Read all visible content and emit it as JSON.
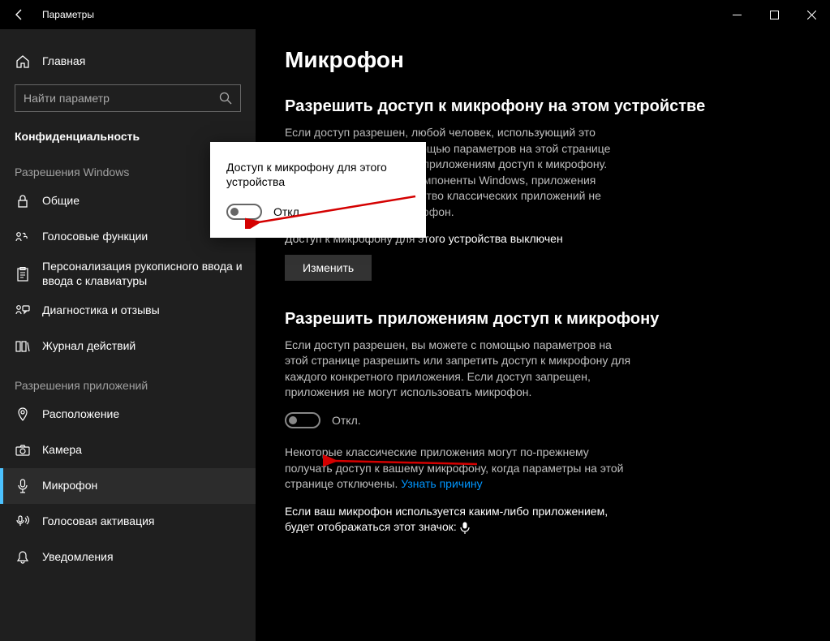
{
  "window": {
    "title": "Параметры"
  },
  "sidebar": {
    "home": "Главная",
    "search_placeholder": "Найти параметр",
    "section": "Конфиденциальность",
    "group1": "Разрешения Windows",
    "items1": [
      "Общие",
      "Голосовые функции",
      "Персонализация рукописного ввода и ввода с клавиатуры",
      "Диагностика и отзывы",
      "Журнал действий"
    ],
    "group2": "Разрешения приложений",
    "items2": [
      "Расположение",
      "Камера",
      "Микрофон",
      "Голосовая активация",
      "Уведомления"
    ]
  },
  "content": {
    "page_title": "Микрофон",
    "h2_1": "Разрешить доступ к микрофону на этом устройстве",
    "desc_1": "Если доступ разрешен, любой человек, использующий это устройство, сможет с помощью параметров на этой странице разрешить или запретить приложениям доступ к микрофону. Если запретить доступ, компоненты Windows, приложения Microsoft Store и большинство классических приложений не смогут использовать микрофон.",
    "status_1": "Доступ к микрофону для этого устройства выключен",
    "change_btn": "Изменить",
    "h2_2": "Разрешить приложениям доступ к микрофону",
    "desc_2": "Если доступ разрешен, вы можете с помощью параметров на этой странице разрешить или запретить доступ к микрофону для каждого конкретного приложения. Если доступ запрещен, приложения не могут использовать микрофон.",
    "toggle_off": "Откл.",
    "desc_3a": "Некоторые классические приложения могут по-прежнему получать доступ к вашему микрофону, когда параметры на этой странице отключены. ",
    "link_reason": "Узнать причину",
    "desc_4": "Если ваш микрофон используется каким-либо приложением, будет отображаться этот значок: "
  },
  "popup": {
    "title": "Доступ к микрофону для этого устройства",
    "toggle_off": "Откл."
  }
}
